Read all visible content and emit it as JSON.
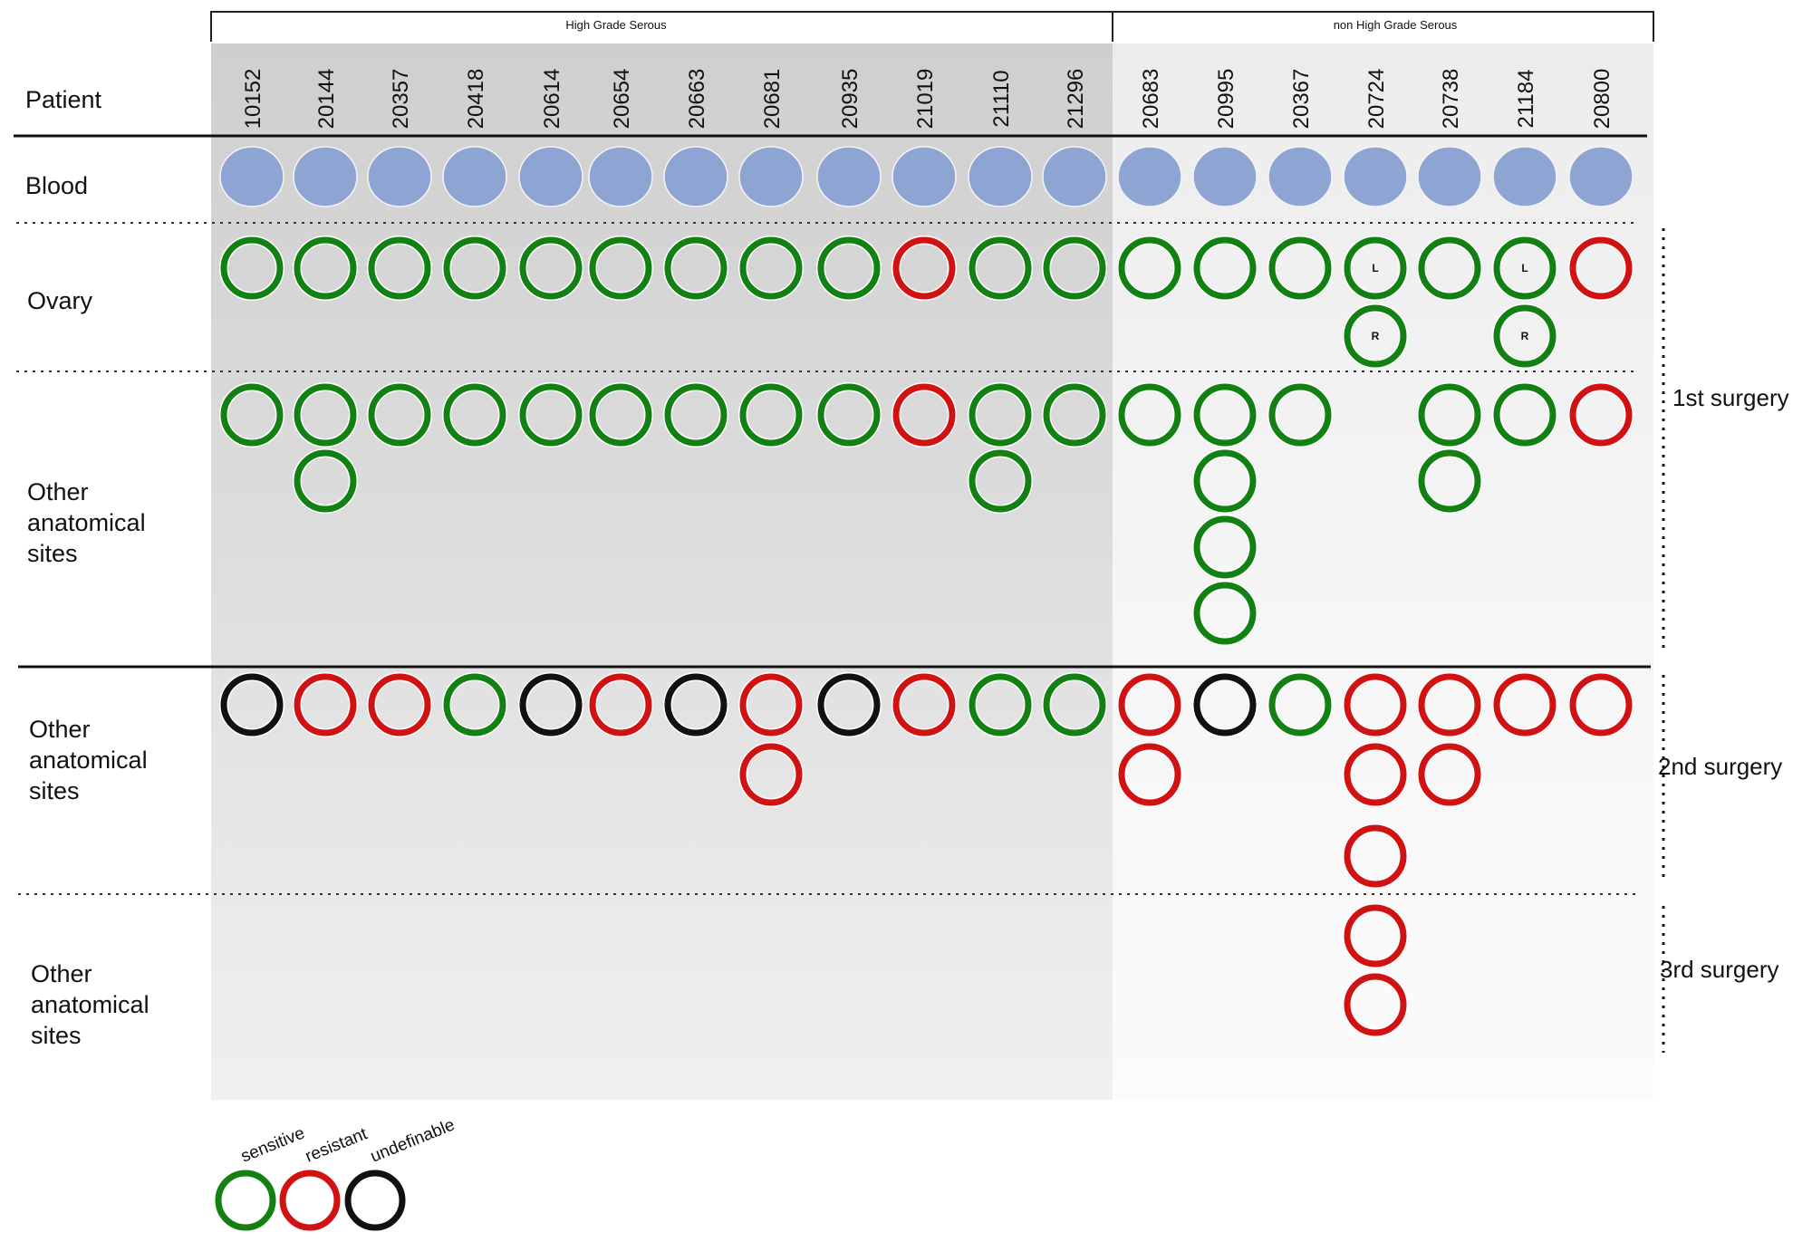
{
  "figure": {
    "row_labels": {
      "patient": "Patient",
      "blood": "Blood",
      "ovary": "Ovary",
      "other_sites_line1": "Other",
      "other_sites_line2": "anatomical",
      "other_sites_line3": "sites"
    },
    "surgery_labels": [
      "1st surgery",
      "2nd surgery",
      "3rd surgery"
    ],
    "groups": [
      {
        "name": "High Grade Serous",
        "patients": [
          "10152",
          "20144",
          "20357",
          "20418",
          "20614",
          "20654",
          "20663",
          "20681",
          "20935",
          "21019",
          "21110",
          "21296"
        ]
      },
      {
        "name": "non High Grade Serous",
        "patients": [
          "20683",
          "20995",
          "20367",
          "20724",
          "20738",
          "21184",
          "20800"
        ]
      }
    ],
    "colors": {
      "sensitive": "#138013",
      "resistant": "#d01212",
      "undefinable": "#111111",
      "blood": "#8ea5d4",
      "hgs_panel": "#d4d4d4",
      "non_hgs_panel": "#f1f1f1"
    },
    "legend": [
      {
        "key": "sensitive",
        "label": "sensitive"
      },
      {
        "key": "resistant",
        "label": "resistant"
      },
      {
        "key": "undefinable",
        "label": "undefinable"
      }
    ]
  },
  "chart_data": {
    "type": "table",
    "title": "",
    "columns": [
      "10152",
      "20144",
      "20357",
      "20418",
      "20614",
      "20654",
      "20663",
      "20681",
      "20935",
      "21019",
      "21110",
      "21296",
      "20683",
      "20995",
      "20367",
      "20724",
      "20738",
      "21184",
      "20800"
    ],
    "column_groups": [
      {
        "name": "High Grade Serous",
        "count": 12
      },
      {
        "name": "non High Grade Serous",
        "count": 7
      }
    ],
    "blood": [
      true,
      true,
      true,
      true,
      true,
      true,
      true,
      true,
      true,
      true,
      true,
      true,
      true,
      true,
      true,
      true,
      true,
      true,
      true
    ],
    "surgery_1_ovary": [
      [
        {
          "s": "sensitive"
        }
      ],
      [
        {
          "s": "sensitive"
        }
      ],
      [
        {
          "s": "sensitive"
        }
      ],
      [
        {
          "s": "sensitive"
        }
      ],
      [
        {
          "s": "sensitive"
        }
      ],
      [
        {
          "s": "sensitive"
        }
      ],
      [
        {
          "s": "sensitive"
        }
      ],
      [
        {
          "s": "sensitive"
        }
      ],
      [
        {
          "s": "sensitive"
        }
      ],
      [
        {
          "s": "resistant"
        }
      ],
      [
        {
          "s": "sensitive"
        }
      ],
      [
        {
          "s": "sensitive"
        }
      ],
      [
        {
          "s": "sensitive"
        }
      ],
      [
        {
          "s": "sensitive"
        }
      ],
      [
        {
          "s": "sensitive"
        }
      ],
      [
        {
          "s": "sensitive",
          "label": "L"
        },
        {
          "s": "sensitive",
          "label": "R"
        }
      ],
      [
        {
          "s": "sensitive"
        }
      ],
      [
        {
          "s": "sensitive",
          "label": "L"
        },
        {
          "s": "sensitive",
          "label": "R"
        }
      ],
      [
        {
          "s": "resistant"
        }
      ]
    ],
    "surgery_1_other": [
      [
        "sensitive"
      ],
      [
        "sensitive",
        "sensitive"
      ],
      [
        "sensitive"
      ],
      [
        "sensitive"
      ],
      [
        "sensitive"
      ],
      [
        "sensitive"
      ],
      [
        "sensitive"
      ],
      [
        "sensitive"
      ],
      [
        "sensitive"
      ],
      [
        "resistant"
      ],
      [
        "sensitive",
        "sensitive"
      ],
      [
        "sensitive"
      ],
      [
        "sensitive"
      ],
      [
        "sensitive",
        "sensitive",
        "sensitive",
        "sensitive"
      ],
      [
        "sensitive"
      ],
      [],
      [
        "sensitive",
        "sensitive"
      ],
      [
        "sensitive"
      ],
      [
        "resistant"
      ]
    ],
    "surgery_2_other": [
      [
        "undefinable"
      ],
      [
        "resistant"
      ],
      [
        "resistant"
      ],
      [
        "sensitive"
      ],
      [
        "undefinable"
      ],
      [
        "resistant"
      ],
      [
        "undefinable"
      ],
      [
        "resistant",
        "resistant"
      ],
      [
        "undefinable"
      ],
      [
        "resistant"
      ],
      [
        "sensitive"
      ],
      [
        "sensitive"
      ],
      [
        "resistant",
        "resistant"
      ],
      [
        "undefinable"
      ],
      [
        "sensitive"
      ],
      [
        "resistant",
        "resistant",
        "resistant"
      ],
      [
        "resistant",
        "resistant"
      ],
      [
        "resistant"
      ],
      [
        "resistant"
      ]
    ],
    "surgery_3_other": [
      [],
      [],
      [],
      [],
      [],
      [],
      [],
      [],
      [],
      [],
      [],
      [],
      [],
      [],
      [],
      [
        "resistant",
        "resistant"
      ],
      [],
      [],
      []
    ],
    "legend": [
      "sensitive",
      "resistant",
      "undefinable"
    ]
  }
}
